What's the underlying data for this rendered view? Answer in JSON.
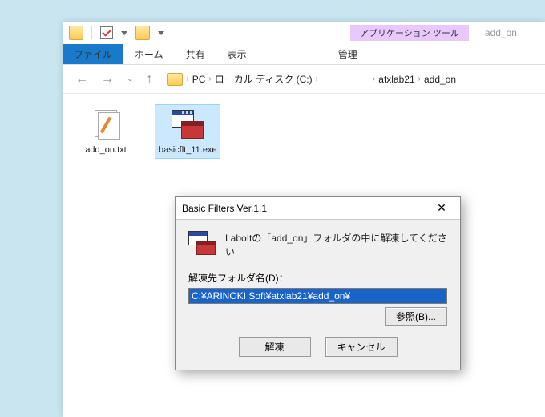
{
  "explorer": {
    "context_tab_header": "アプリケーション ツール",
    "context_title": "add_on",
    "tabs": {
      "file": "ファイル",
      "home": "ホーム",
      "share": "共有",
      "view": "表示",
      "manage": "管理"
    },
    "breadcrumb": {
      "root": "PC",
      "drive": "ローカル ディスク (C:)",
      "folder1": "atxlab21",
      "folder2": "add_on",
      "sep": "›"
    },
    "files": {
      "item1": "add_on.txt",
      "item2": "basicflt_11.exe"
    }
  },
  "dialog": {
    "title": "Basic Filters Ver.1.1",
    "close": "✕",
    "message": "LabоItの「add_on」フォルダの中に解凍してください",
    "dest_label": "解凍先フォルダ名(D)：",
    "dest_value": "C:¥ARINOKI Soft¥atxlab21¥add_on¥",
    "browse": "参照(B)...",
    "extract": "解凍",
    "cancel": "キャンセル"
  }
}
